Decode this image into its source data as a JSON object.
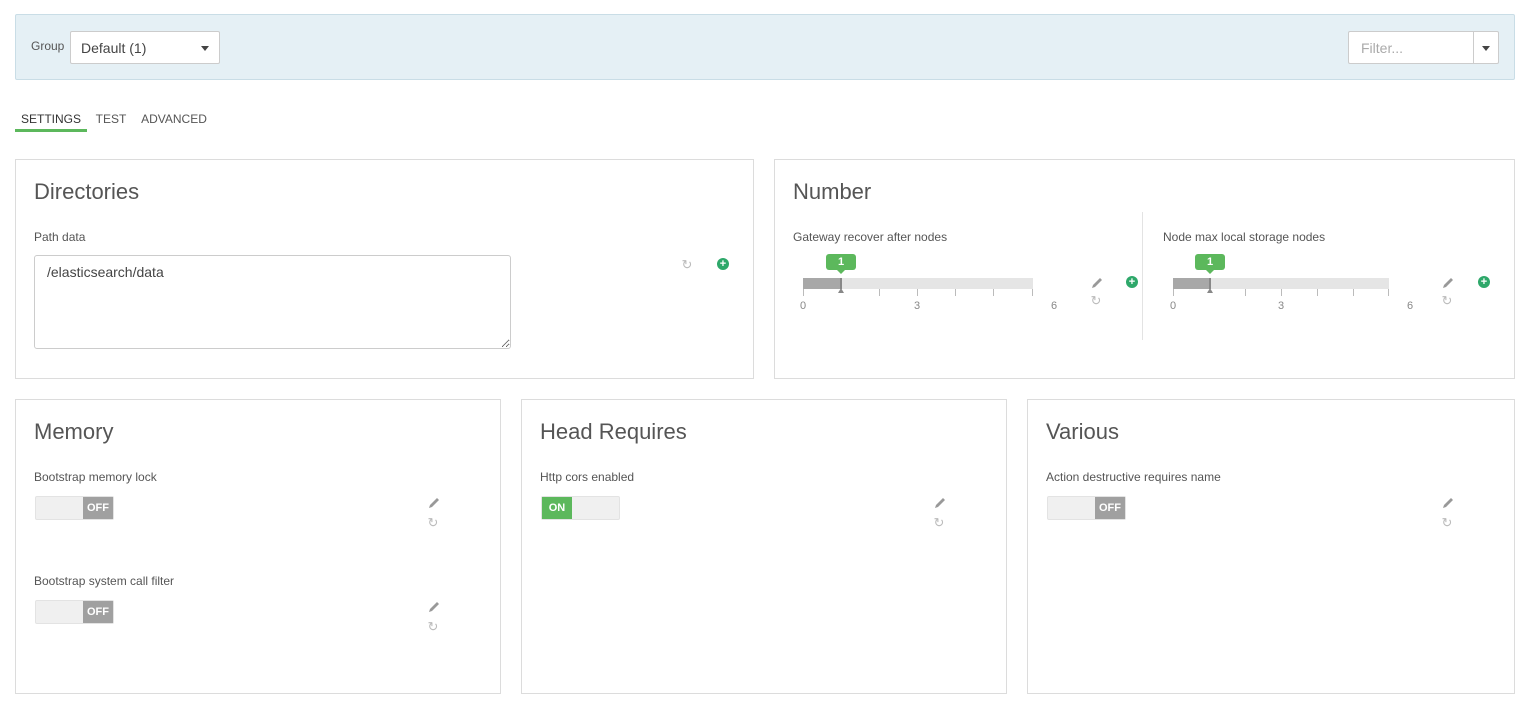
{
  "toolbar": {
    "group_label": "Group",
    "group_value": "Default (1)",
    "filter_placeholder": "Filter..."
  },
  "tabs": [
    {
      "label": "SETTINGS",
      "active": true
    },
    {
      "label": "TEST",
      "active": false
    },
    {
      "label": "ADVANCED",
      "active": false
    }
  ],
  "directories": {
    "title": "Directories",
    "path_label": "Path data",
    "path_value": "/elasticsearch/data"
  },
  "number": {
    "title": "Number",
    "gateway": {
      "label": "Gateway recover after nodes",
      "value": "1",
      "min": "0",
      "mid": "3",
      "max": "6"
    },
    "node_max": {
      "label": "Node max local storage nodes",
      "value": "1",
      "min": "0",
      "mid": "3",
      "max": "6"
    }
  },
  "memory": {
    "title": "Memory",
    "memory_lock": {
      "label": "Bootstrap memory lock",
      "state": "OFF"
    },
    "syscall": {
      "label": "Bootstrap system call filter",
      "state": "OFF"
    }
  },
  "head": {
    "title": "Head Requires",
    "cors": {
      "label": "Http cors enabled",
      "state": "ON"
    }
  },
  "various": {
    "title": "Various",
    "destructive": {
      "label": "Action destructive requires name",
      "state": "OFF"
    }
  },
  "colors": {
    "accent": "#5cb85c",
    "plus": "#2ea86a",
    "topbar_bg": "#e5f0f5"
  }
}
